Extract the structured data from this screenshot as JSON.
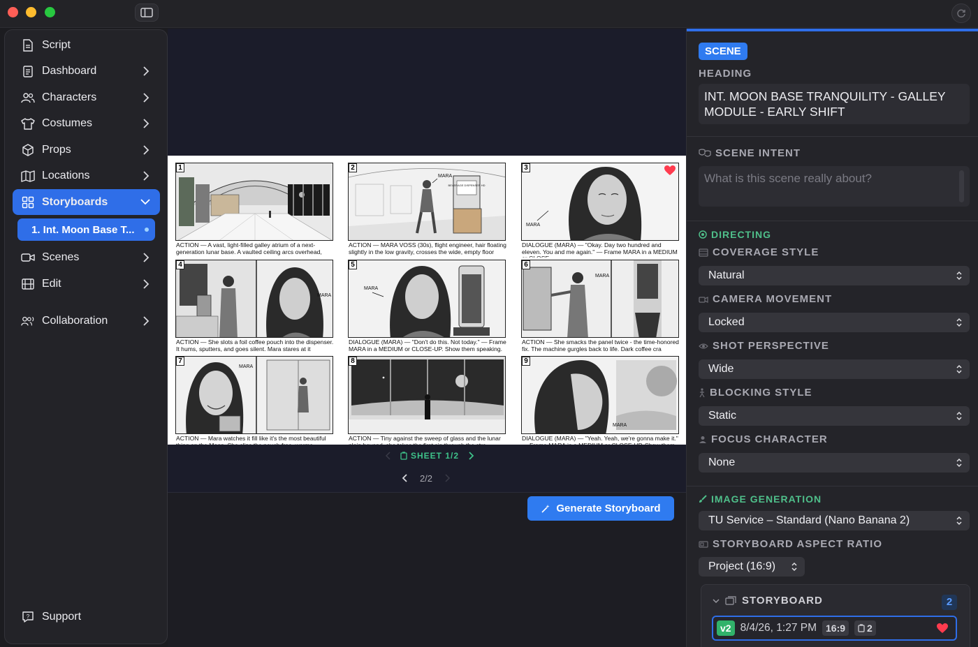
{
  "sidebar": {
    "items": [
      {
        "label": "Script"
      },
      {
        "label": "Dashboard"
      },
      {
        "label": "Characters"
      },
      {
        "label": "Costumes"
      },
      {
        "label": "Props"
      },
      {
        "label": "Locations"
      },
      {
        "label": "Storyboards"
      },
      {
        "label": "Scenes"
      },
      {
        "label": "Edit"
      },
      {
        "label": "Collaboration"
      },
      {
        "label": "Support"
      }
    ],
    "sub_item": "1. Int. Moon Base T..."
  },
  "sheet": {
    "panels": [
      {
        "num": "1",
        "caption": "ACTION — A vast, light-filled galley atrium of a next-generation lunar base. A vaulted ceiling arcs overhead,"
      },
      {
        "num": "2",
        "caption": "ACTION — MARA VOSS (30s), flight engineer, hair floating slightly in the low gravity, crosses the wide, empty floor"
      },
      {
        "num": "3",
        "caption": "DIALOGUE (MARA) — \"Okay. Day two hundred and eleven. You and me again.\" — Frame MARA in a MEDIUM or CLOSE-"
      },
      {
        "num": "4",
        "caption": "ACTION — She slots a foil coffee pouch into the dispenser. It hums, sputters, and goes silent. Mara stares at it"
      },
      {
        "num": "5",
        "caption": "DIALOGUE (MARA) — \"Don't do this. Not today.\"   — Frame MARA in a MEDIUM or CLOSE-UP. Show them speaking."
      },
      {
        "num": "6",
        "caption": "ACTION — She smacks the panel twice - the time-honored fix. The machine gurgles back to life. Dark coffee cra"
      },
      {
        "num": "7",
        "caption": "ACTION — Mara watches it fill like it's the most beautiful thing on the Moon. She clips the pouch free, warms"
      },
      {
        "num": "8",
        "caption": "ACTION — Tiny against the sweep of glass and the lunar plain beyond, she takes the first sip through the stra"
      },
      {
        "num": "9",
        "caption": "DIALOGUE (MARA) — \"Yeah. Yeah, we're gonna make it.\" — Frame MARA in a MEDIUM or CLOSE-UP. Show them speaking."
      }
    ],
    "labels": {
      "mara": "MARA",
      "beverage": "BEVERAGE DISPENSER HD"
    }
  },
  "pager": {
    "sheet_label": "SHEET 1/2",
    "page_label": "2/2"
  },
  "generate_button": "Generate Storyboard",
  "inspector": {
    "badge": "SCENE",
    "heading_label": "HEADING",
    "heading_value": "INT. MOON BASE TRANQUILITY - GALLEY MODULE - EARLY SHIFT",
    "intent_label": "SCENE INTENT",
    "intent_placeholder": "What is this scene really about?",
    "directing_label": "DIRECTING",
    "coverage_label": "COVERAGE STYLE",
    "coverage_value": "Natural",
    "camera_label": "CAMERA MOVEMENT",
    "camera_value": "Locked",
    "perspective_label": "SHOT PERSPECTIVE",
    "perspective_value": "Wide",
    "blocking_label": "BLOCKING STYLE",
    "blocking_value": "Static",
    "focus_label": "FOCUS CHARACTER",
    "focus_value": "None",
    "imagegen_label": "IMAGE GENERATION",
    "imagegen_value": "TU Service – Standard (Nano Banana 2)",
    "aspect_label": "STORYBOARD ASPECT RATIO",
    "aspect_value": "Project (16:9)",
    "storyboard_label": "STORYBOARD",
    "storyboard_count": "2",
    "version": {
      "badge": "v2",
      "date": "8/4/26, 1:27 PM",
      "aspect": "16:9",
      "sheets": "2"
    }
  },
  "colors": {
    "accent": "#2f6ee8",
    "green": "#4fbf8a",
    "heart": "#ff3b4e"
  }
}
